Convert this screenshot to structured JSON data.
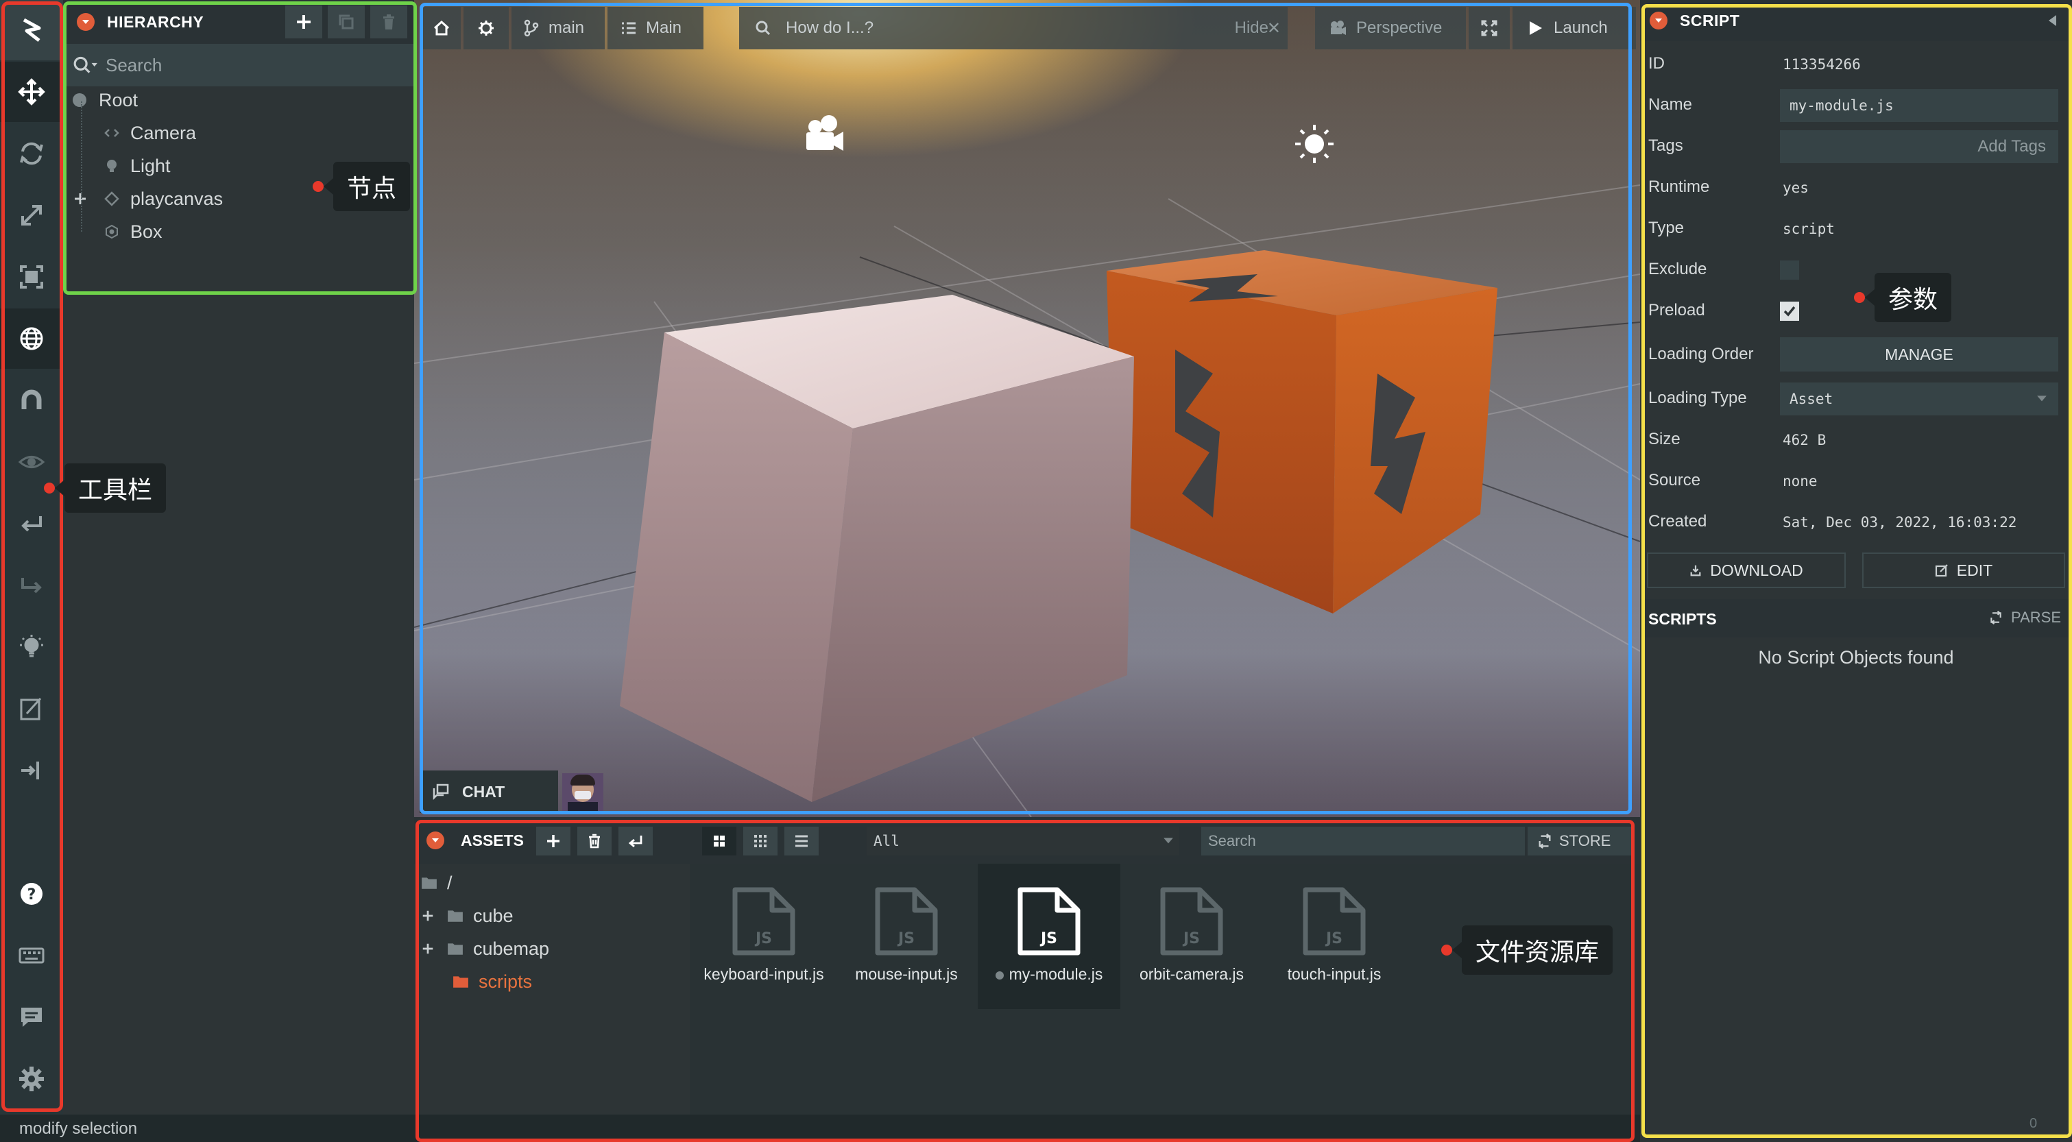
{
  "colors": {
    "accent_orange": "#e15d3a",
    "panel_bg": "#2d3436",
    "outline_red": "#e8392b",
    "outline_green": "#6fd34a",
    "outline_blue": "#3ea0ff",
    "outline_yellow": "#f5e04a"
  },
  "hierarchy": {
    "title": "HIERARCHY",
    "search_placeholder": "Search",
    "tree": [
      "Root",
      "Camera",
      "Light",
      "playcanvas",
      "Box"
    ]
  },
  "viewport": {
    "home_icon": "home-icon",
    "branch_label": "main",
    "scene_label": "Main",
    "help_search_placeholder": "How do I...?",
    "hide_label": "Hide",
    "camera_mode": "Perspective",
    "launch_label": "Launch",
    "chat_label": "CHAT"
  },
  "assets": {
    "title": "ASSETS",
    "filter_value": "All",
    "search_placeholder": "Search",
    "store_label": "STORE",
    "folders": [
      "/",
      "cube",
      "cubemap",
      "scripts"
    ],
    "files": [
      "keyboard-input.js",
      "mouse-input.js",
      "my-module.js",
      "orbit-camera.js",
      "touch-input.js"
    ],
    "file_icon_text": "JS",
    "selected_file": "my-module.js"
  },
  "inspector": {
    "title": "SCRIPT",
    "fields": {
      "id_label": "ID",
      "id_value": "113354266",
      "name_label": "Name",
      "name_value": "my-module.js",
      "tags_label": "Tags",
      "tags_placeholder": "Add Tags",
      "runtime_label": "Runtime",
      "runtime_value": "yes",
      "type_label": "Type",
      "type_value": "script",
      "exclude_label": "Exclude",
      "preload_label": "Preload",
      "loading_order_label": "Loading Order",
      "manage_label": "MANAGE",
      "loading_type_label": "Loading Type",
      "loading_type_value": "Asset",
      "size_label": "Size",
      "size_value": "462 B",
      "source_label": "Source",
      "source_value": "none",
      "created_label": "Created",
      "created_value": "Sat, Dec 03, 2022, 16:03:22"
    },
    "exclude_checked": false,
    "preload_checked": true,
    "download_label": "DOWNLOAD",
    "edit_label": "EDIT",
    "scripts_title": "SCRIPTS",
    "parse_label": "PARSE",
    "no_scripts": "No Script Objects found",
    "footer_count": "0"
  },
  "status_bar": {
    "text": "modify selection"
  },
  "annotations": {
    "toolbar": "工具栏",
    "nodes": "节点",
    "params": "参数",
    "assets": "文件资源库"
  }
}
